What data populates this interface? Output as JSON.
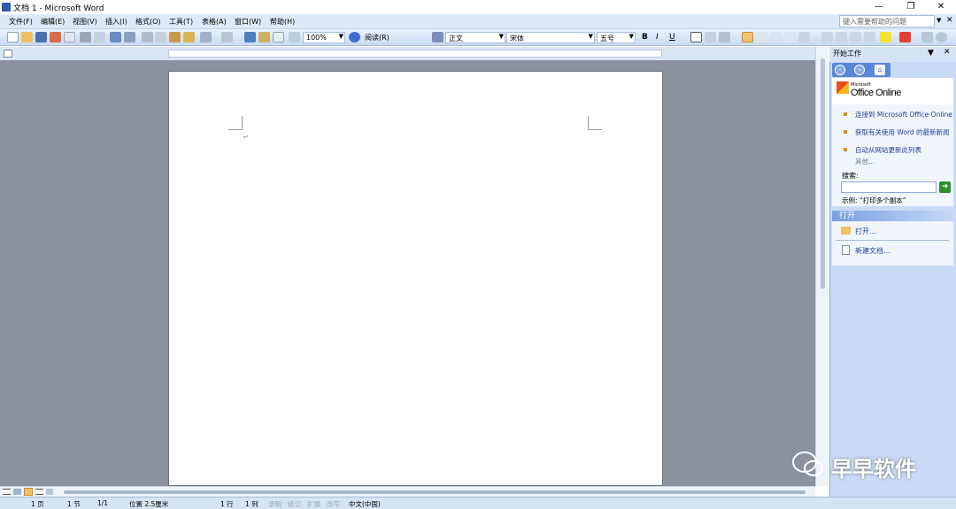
{
  "window": {
    "title": "文档 1 - Microsoft Word",
    "controls": [
      "—",
      "❐",
      "✕"
    ]
  },
  "menu": [
    "文件(F)",
    "编辑(E)",
    "视图(V)",
    "插入(I)",
    "格式(O)",
    "工具(T)",
    "表格(A)",
    "窗口(W)",
    "帮助(H)"
  ],
  "help": {
    "placeholder": "键入需要帮助的问题"
  },
  "toolbar": {
    "zoom": "100%",
    "read": "阅读(R)",
    "style": "正文",
    "font": "宋体",
    "size": "五号"
  },
  "taskpane": {
    "title": "开始工作",
    "logo_small": "Microsoft",
    "logo_main": "Office Online",
    "links": [
      "连接到 Microsoft Office Online",
      "获取有关使用 Word 的最新新闻",
      "自动从网站更新此列表"
    ],
    "more": "其他...",
    "search_label": "搜索:",
    "example": "示例: “打印多个副本”",
    "open_section": "打开",
    "open_link": "打开...",
    "new_link": "新建文档..."
  },
  "status": {
    "page": "1 页",
    "section": "1 节",
    "pages": "1/1",
    "position": "位置 2.5厘米",
    "line": "1 行",
    "col": "1 列",
    "rec": "录制",
    "trk": "修订",
    "ext": "扩展",
    "ovr": "改写",
    "lang": "中文(中国)"
  },
  "watermark": "早早软件",
  "colors": {
    "accent": "#3c6fd1",
    "menubar": "#dde9f8",
    "workspace": "#8b929e"
  }
}
